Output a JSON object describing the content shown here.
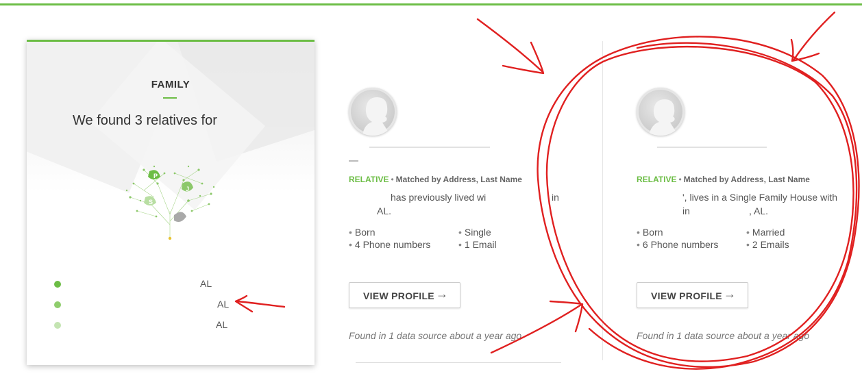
{
  "family": {
    "title": "FAMILY",
    "heading": "We found 3 relatives for",
    "tree_leaves": [
      "P",
      "J",
      "S"
    ],
    "relatives": [
      {
        "suffix": "AL",
        "color": "#6cbd45"
      },
      {
        "suffix": "AL",
        "color": "#8fcd6d"
      },
      {
        "suffix": "AL",
        "color": "#c4e4b2"
      }
    ]
  },
  "results": [
    {
      "tag": "RELATIVE",
      "match": "Matched by Address, Last Name",
      "desc_line1": "has previously lived wi",
      "desc_line1_tail": "in",
      "desc_line2": "AL.",
      "facts": [
        "Born",
        "Single",
        "4 Phone numbers",
        "1 Email"
      ],
      "button": "VIEW PROFILE",
      "found": "Found in 1 data source about a year ago"
    },
    {
      "tag": "RELATIVE",
      "match": "Matched by Address, Last Name",
      "desc_line1": "', lives in a Single Family House with",
      "desc_line2_a": "in",
      "desc_line2_b": ", AL.",
      "facts": [
        "Born",
        "Married",
        "6 Phone numbers",
        "2 Emails"
      ],
      "button": "VIEW PROFILE",
      "found": "Found in 1 data source about a year ago"
    }
  ],
  "icons": {
    "arrow": "arrow-right-icon",
    "avatar": "person-silhouette-icon",
    "tree": "family-tree-icon"
  },
  "colors": {
    "accent": "#6cbd45",
    "annotation": "#e02020"
  }
}
